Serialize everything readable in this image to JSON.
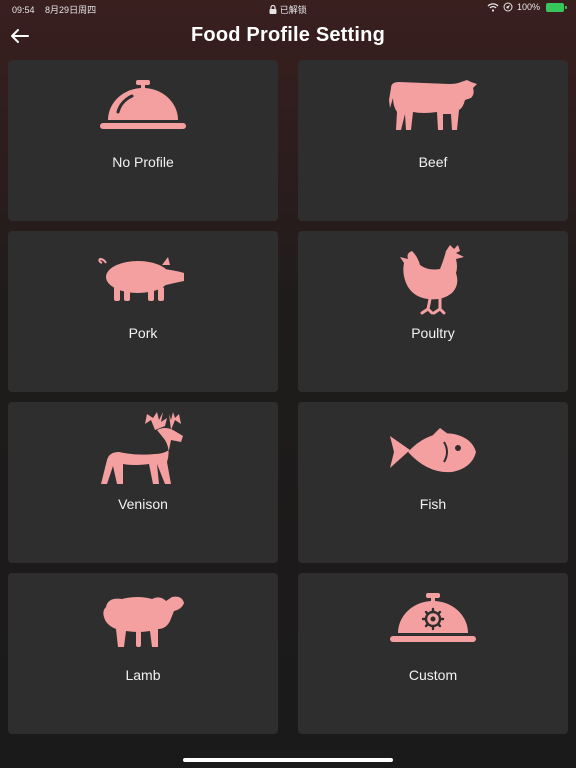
{
  "status_bar": {
    "time": "09:54",
    "date": "8月29日周四",
    "lock_text": "已解锁",
    "battery": "100%"
  },
  "header": {
    "title": "Food Profile Setting"
  },
  "profiles": [
    {
      "label": "No Profile",
      "icon": "cloche-icon"
    },
    {
      "label": "Beef",
      "icon": "cow-icon"
    },
    {
      "label": "Pork",
      "icon": "pig-icon"
    },
    {
      "label": "Poultry",
      "icon": "chicken-icon"
    },
    {
      "label": "Venison",
      "icon": "deer-icon"
    },
    {
      "label": "Fish",
      "icon": "fish-icon"
    },
    {
      "label": "Lamb",
      "icon": "sheep-icon"
    },
    {
      "label": "Custom",
      "icon": "cloche-gear-icon"
    }
  ],
  "colors": {
    "icon": "#f4a0a0",
    "card": "#2e2e2e",
    "battery": "#35c759"
  }
}
